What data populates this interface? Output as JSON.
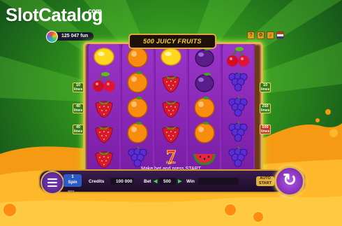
{
  "logo": {
    "part1": "Slot",
    "part2": "Catalog",
    "domain": ".com"
  },
  "balance": {
    "value": "125 047 fun"
  },
  "game_title": "500 JUICY FRUITS",
  "top_icons": [
    "?",
    "⚙",
    "♪",
    "flag"
  ],
  "left_lines": [
    {
      "value": "10",
      "label": "lines"
    },
    {
      "value": "40",
      "label": "lines"
    },
    {
      "value": "40",
      "label": "lines"
    }
  ],
  "right_lines": [
    {
      "value": "10",
      "label": "lines"
    },
    {
      "value": "250",
      "label": "lines"
    },
    {
      "value": "500",
      "label": "lines"
    }
  ],
  "reels": [
    [
      "lemon",
      "cherry",
      "strawberry",
      "strawberry",
      "strawberry"
    ],
    [
      "orange",
      "orange",
      "orange",
      "orange",
      "grapes"
    ],
    [
      "lemon",
      "strawberry",
      "strawberry",
      "strawberry",
      "seven"
    ],
    [
      "plum",
      "plum",
      "orange",
      "orange",
      "watermelon"
    ],
    [
      "cherry",
      "grapes",
      "grapes",
      "grapes",
      "grapes"
    ]
  ],
  "seven_label": "Fruits",
  "message": "Make bet and press START",
  "controls": {
    "spins_value": "1",
    "spins_label": "Spin",
    "credits_label": "Credits",
    "credits_value": "100 000",
    "bet_label": "Bet",
    "bet_value": "500",
    "win_label": "Win",
    "win_value": "",
    "auto_label": "AUTO START",
    "spin_glyph": "↻",
    "small_under_spins": "spins",
    "small_under_spin": "start"
  },
  "colors": {
    "accent": "#e8b24a",
    "reel": "#8e2bbb",
    "background": "#2b8a1c"
  }
}
